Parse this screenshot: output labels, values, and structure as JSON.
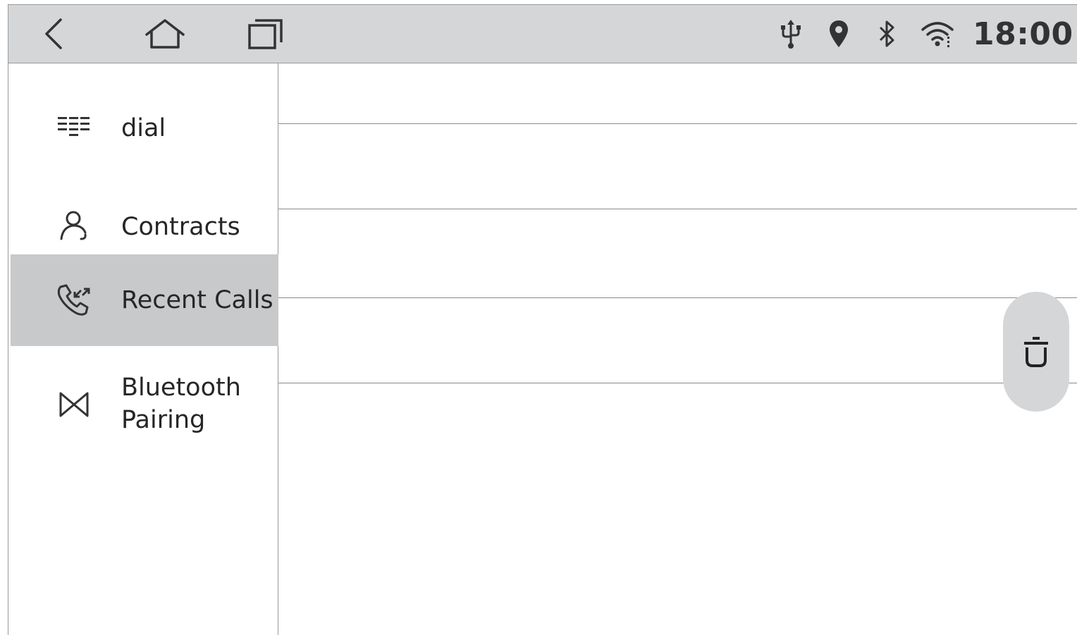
{
  "status_bar": {
    "nav": {
      "back_icon": "chevron-left-icon",
      "home_icon": "home-icon",
      "recents_icon": "recents-icon"
    },
    "indicators": [
      "usb-icon",
      "location-icon",
      "bluetooth-icon",
      "wifi-icon"
    ],
    "time": "18:00"
  },
  "sidebar": {
    "items": [
      {
        "label": "dial",
        "icon": "dialpad-icon",
        "active": false
      },
      {
        "label": "Contracts",
        "icon": "person-icon",
        "active": false
      },
      {
        "label": "Recent Calls",
        "icon": "call-log-icon",
        "active": true
      },
      {
        "label_line1": "Bluetooth",
        "label_line2": "Pairing",
        "icon": "bluetooth-pairing-icon",
        "active": false
      }
    ]
  },
  "call_list": {
    "rows": [
      "",
      "",
      "",
      ""
    ]
  },
  "actions": {
    "delete_icon": "trash-icon"
  },
  "colors": {
    "bar_bg": "#d5d6d8",
    "active_item_bg": "#c8c9cb",
    "text": "#262626",
    "divider": "#8a8a8a"
  }
}
